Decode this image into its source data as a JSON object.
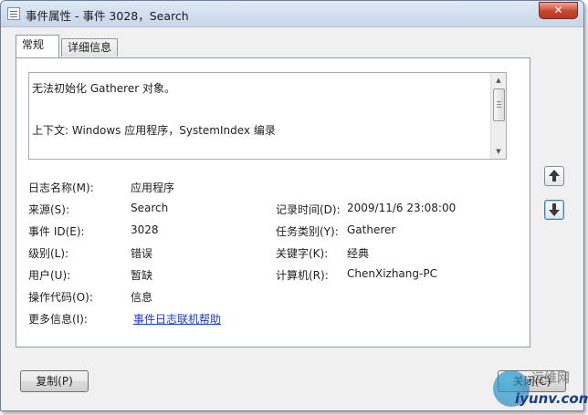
{
  "window": {
    "title": "事件属性 - 事件 3028，Search",
    "close_glyph": "✕"
  },
  "tabs": [
    {
      "label": "常规",
      "active": true
    },
    {
      "label": "详细信息",
      "active": false
    }
  ],
  "message": {
    "line1": "无法初始化 Gatherer 对象。",
    "line2": "上下文: Windows 应用程序，SystemIndex 编录"
  },
  "fields": {
    "log_name": {
      "label": "日志名称(M):",
      "value": "应用程序"
    },
    "source": {
      "label": "来源(S):",
      "value": "Search"
    },
    "logged": {
      "label": "记录时间(D):",
      "value": "2009/11/6 23:08:00"
    },
    "event_id": {
      "label": "事件 ID(E):",
      "value": "3028"
    },
    "task_category": {
      "label": "任务类别(Y):",
      "value": "Gatherer"
    },
    "level": {
      "label": "级别(L):",
      "value": "错误"
    },
    "keywords": {
      "label": "关键字(K):",
      "value": "经典"
    },
    "user": {
      "label": "用户(U):",
      "value": "暂缺"
    },
    "computer": {
      "label": "计算机(R):",
      "value": "ChenXizhang-PC"
    },
    "opcode": {
      "label": "操作代码(O):",
      "value": "信息"
    },
    "more_info": {
      "label": "更多信息(I):",
      "value": "事件日志联机帮助"
    }
  },
  "nav": {
    "up_icon": "arrow-up-icon",
    "down_icon": "arrow-down-icon"
  },
  "buttons": {
    "copy": "复制(P)",
    "close": "关闭(C)"
  },
  "watermark": {
    "name": "运维网",
    "url": "iyunv.com"
  },
  "colors": {
    "link": "#1a3cc6",
    "close_button": "#c7462f",
    "titlebar": "#c7d6e9"
  }
}
